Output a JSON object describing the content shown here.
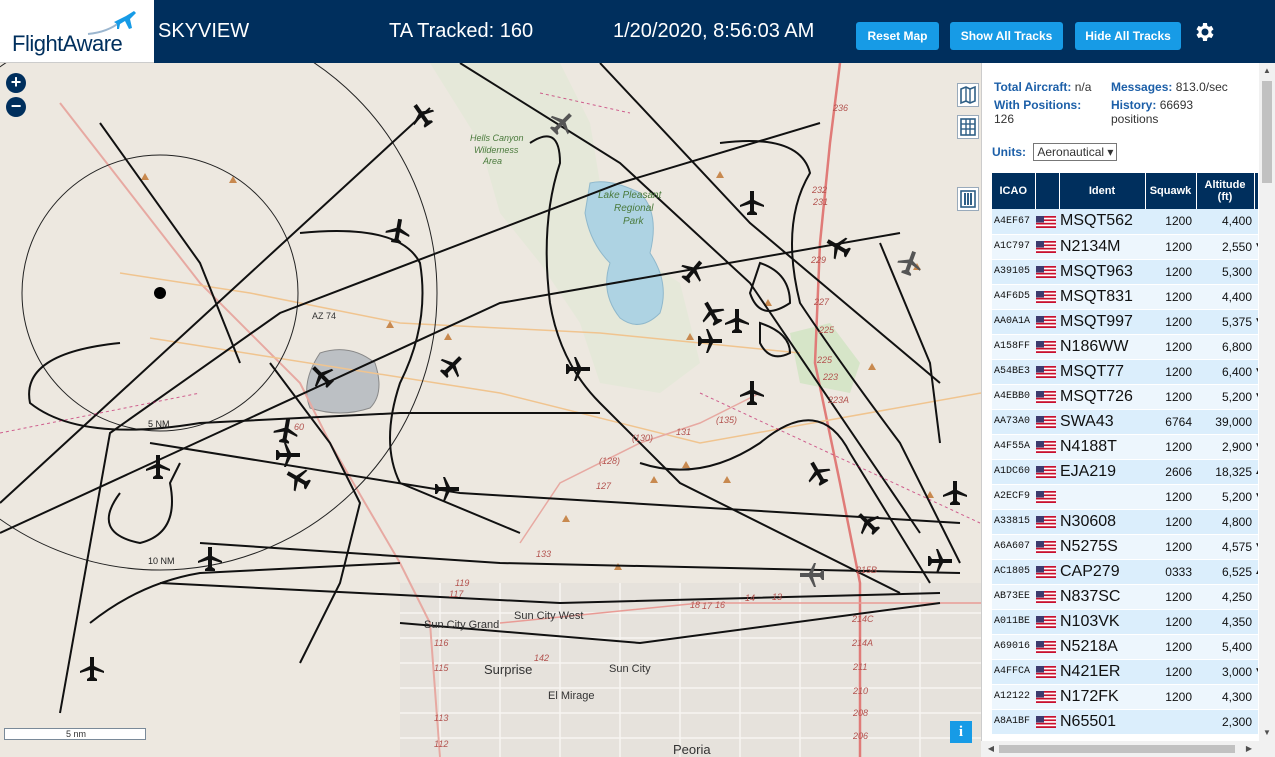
{
  "header": {
    "logo_text": "FlightAware",
    "app_name": "SKYVIEW",
    "ta_tracked": "TA Tracked: 160",
    "clock": "1/20/2020, 8:56:03 AM",
    "buttons": {
      "reset": "Reset Map",
      "show": "Show All Tracks",
      "hide": "Hide All Tracks"
    }
  },
  "map": {
    "zoom_in": "+",
    "zoom_out": "−",
    "scale_label": "5 nm",
    "info": "i",
    "range_rings": [
      "5 NM",
      "10 NM"
    ],
    "place_labels": {
      "wilderness": [
        "Hells Canyon",
        "Wilderness",
        "Area"
      ],
      "park": [
        "Lake Pleasant",
        "Regional",
        "Park"
      ],
      "highway_az74": "AZ 74",
      "sun_city_west": "Sun City West",
      "sun_city_grand": "Sun City Grand",
      "surprise": "Surprise",
      "sun_city": "Sun City",
      "el_mirage": "El Mirage",
      "peoria": "Peoria"
    },
    "road_numbers": {
      "r236": "236",
      "r232": "232",
      "r231": "231",
      "r229": "229",
      "r227": "227",
      "r225a": "225",
      "r225b": "225",
      "r223": "223",
      "r223a": "223A",
      "r131": "131",
      "r130": "(130)",
      "r135": "(135)",
      "r128": "(128)",
      "r127": "127",
      "r119": "119",
      "r117": "117",
      "r142": "142",
      "r115": "115",
      "r113": "113",
      "r112": "112",
      "r116": "116",
      "r214c": "214C",
      "r214a": "214A",
      "r211": "211",
      "r210": "210",
      "r208": "208",
      "r206": "206",
      "r215b": "215B",
      "r133": "133",
      "r14": "14",
      "r13": "13",
      "r16": "16",
      "r17": "17",
      "r18": "18",
      "r60": "60"
    }
  },
  "panel": {
    "total_aircraft_label": "Total Aircraft:",
    "total_aircraft_value": "n/a",
    "with_positions_label": "With Positions:",
    "with_positions_value": "126",
    "messages_label": "Messages:",
    "messages_value": "813.0/sec",
    "history_label": "History:",
    "history_value": "66693",
    "history_unit": "positions",
    "units_label": "Units:",
    "units_value": "Aeronautical",
    "columns": [
      "ICAO",
      "",
      "Ident",
      "Squawk",
      "Altitude (ft)"
    ],
    "rows": [
      {
        "icao": "A4EF67",
        "ident": "MSQT562",
        "squawk": "1200",
        "alt": "4,400",
        "trend": ""
      },
      {
        "icao": "A1C797",
        "ident": "N2134M",
        "squawk": "1200",
        "alt": "2,550",
        "trend": "▼"
      },
      {
        "icao": "A39105",
        "ident": "MSQT963",
        "squawk": "1200",
        "alt": "5,300",
        "trend": ""
      },
      {
        "icao": "A4F6D5",
        "ident": "MSQT831",
        "squawk": "1200",
        "alt": "4,400",
        "trend": ""
      },
      {
        "icao": "AA0A1A",
        "ident": "MSQT997",
        "squawk": "1200",
        "alt": "5,375",
        "trend": "▼"
      },
      {
        "icao": "A158FF",
        "ident": "N186WW",
        "squawk": "1200",
        "alt": "6,800",
        "trend": ""
      },
      {
        "icao": "A54BE3",
        "ident": "MSQT77",
        "squawk": "1200",
        "alt": "6,400",
        "trend": "▼"
      },
      {
        "icao": "A4EBB0",
        "ident": "MSQT726",
        "squawk": "1200",
        "alt": "5,200",
        "trend": "▼"
      },
      {
        "icao": "AA73A0",
        "ident": "SWA43",
        "squawk": "6764",
        "alt": "39,000",
        "trend": ""
      },
      {
        "icao": "A4F55A",
        "ident": "N4188T",
        "squawk": "1200",
        "alt": "2,900",
        "trend": "▼"
      },
      {
        "icao": "A1DC60",
        "ident": "EJA219",
        "squawk": "2606",
        "alt": "18,325",
        "trend": "▲"
      },
      {
        "icao": "A2ECF9",
        "ident": "",
        "squawk": "1200",
        "alt": "5,200",
        "trend": "▼"
      },
      {
        "icao": "A33815",
        "ident": "N30608",
        "squawk": "1200",
        "alt": "4,800",
        "trend": ""
      },
      {
        "icao": "A6A607",
        "ident": "N5275S",
        "squawk": "1200",
        "alt": "4,575",
        "trend": "▼"
      },
      {
        "icao": "AC1805",
        "ident": "CAP279",
        "squawk": "0333",
        "alt": "6,525",
        "trend": "▲"
      },
      {
        "icao": "AB73EE",
        "ident": "N837SC",
        "squawk": "1200",
        "alt": "4,250",
        "trend": ""
      },
      {
        "icao": "A011BE",
        "ident": "N103VK",
        "squawk": "1200",
        "alt": "4,350",
        "trend": ""
      },
      {
        "icao": "A69016",
        "ident": "N5218A",
        "squawk": "1200",
        "alt": "5,400",
        "trend": ""
      },
      {
        "icao": "A4FFCA",
        "ident": "N421ER",
        "squawk": "1200",
        "alt": "3,000",
        "trend": "▼"
      },
      {
        "icao": "A12122",
        "ident": "N172FK",
        "squawk": "1200",
        "alt": "4,300",
        "trend": ""
      },
      {
        "icao": "A8A1BF",
        "ident": "N65501",
        "squawk": "",
        "alt": "2,300",
        "trend": ""
      }
    ]
  },
  "colors": {
    "header_bg": "#002f5d",
    "button_bg": "#179be6",
    "row_odd": "#dbeefc",
    "row_even": "#edf6fd",
    "map_bg": "#ede8e0"
  },
  "icons": {
    "settings": "gear-icon",
    "map_toggle": "map-icon",
    "grid_toggle": "grid-icon",
    "columns_toggle": "columns-icon",
    "logo": "plane-logo-icon"
  }
}
